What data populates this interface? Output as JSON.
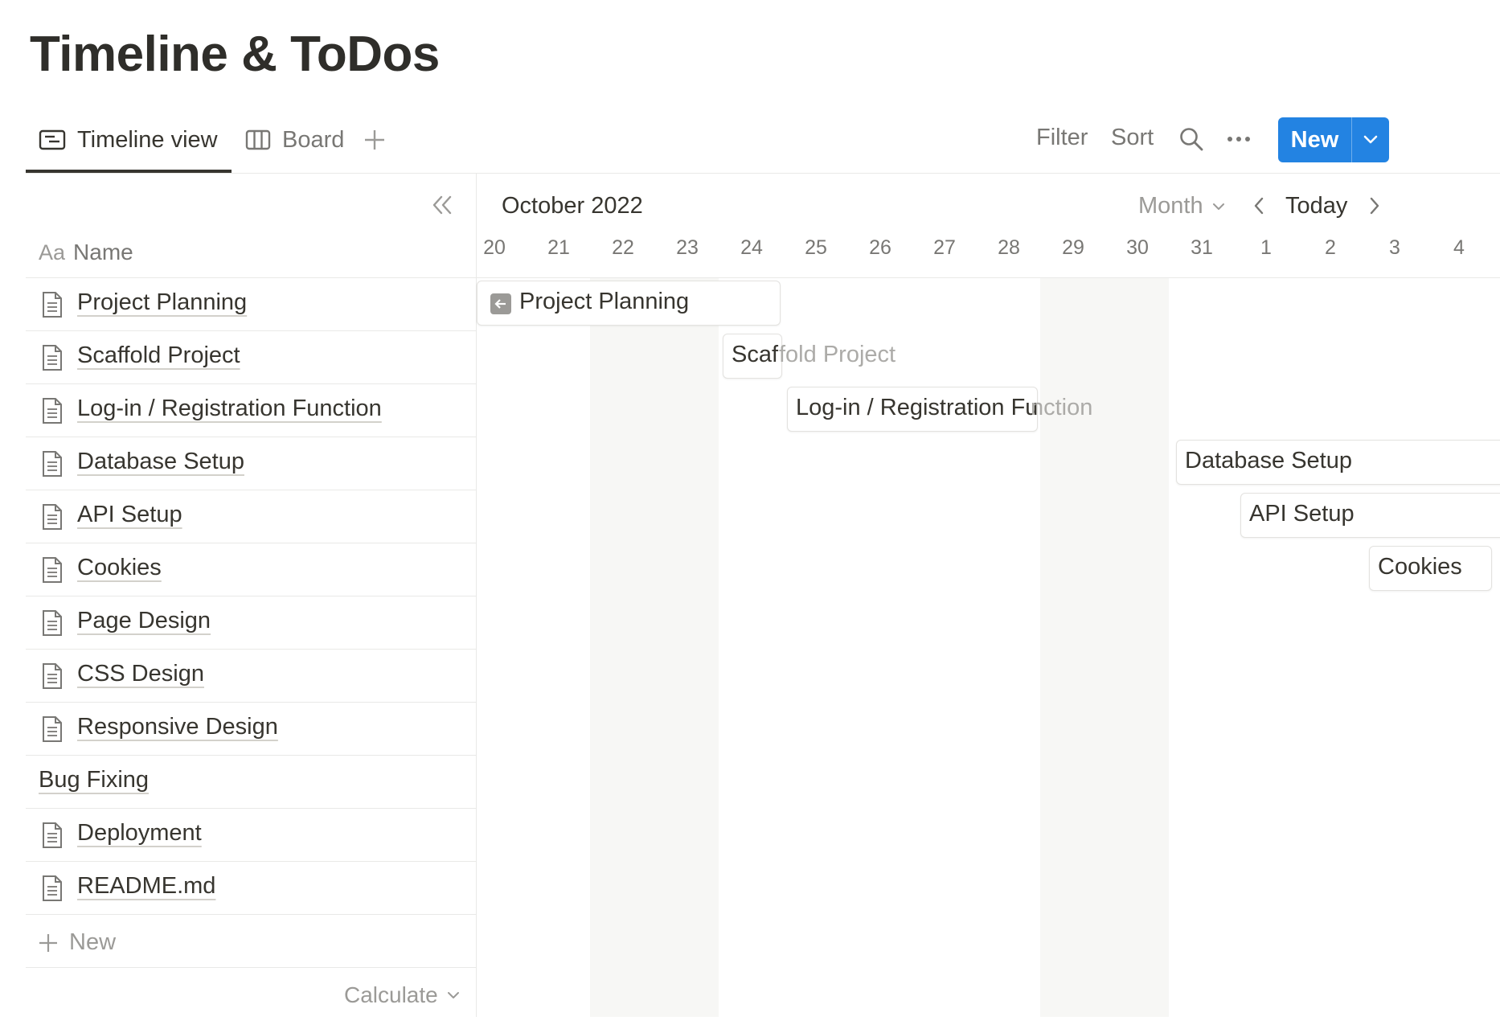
{
  "page": {
    "title": "Timeline & ToDos"
  },
  "views": {
    "tabs": [
      {
        "label": "Timeline view",
        "icon": "timeline-view-icon",
        "active": true
      },
      {
        "label": "Board",
        "icon": "board-view-icon",
        "active": false
      }
    ],
    "add_icon": "plus-icon"
  },
  "toolbar": {
    "filter_label": "Filter",
    "sort_label": "Sort",
    "search_icon": "search-icon",
    "more_icon": "more-horizontal-icon",
    "new_label": "New",
    "new_dropdown_icon": "chevron-down-icon",
    "accent_color": "#2383e2"
  },
  "table": {
    "name_header_prefix": "Aa",
    "name_header": "Name",
    "rows": [
      {
        "name": "Project Planning",
        "has_doc_icon": true
      },
      {
        "name": "Scaffold Project",
        "has_doc_icon": true
      },
      {
        "name": "Log-in / Registration Function",
        "has_doc_icon": true
      },
      {
        "name": "Database Setup",
        "has_doc_icon": true
      },
      {
        "name": "API Setup",
        "has_doc_icon": true
      },
      {
        "name": "Cookies",
        "has_doc_icon": true
      },
      {
        "name": "Page Design",
        "has_doc_icon": true
      },
      {
        "name": "CSS Design",
        "has_doc_icon": true
      },
      {
        "name": "Responsive Design",
        "has_doc_icon": true
      },
      {
        "name": "Bug Fixing",
        "has_doc_icon": false
      },
      {
        "name": "Deployment",
        "has_doc_icon": true
      },
      {
        "name": "README.md",
        "has_doc_icon": true
      }
    ],
    "add_new_label": "New",
    "calculate_label": "Calculate"
  },
  "timeline": {
    "month_label": "October 2022",
    "mode_label": "Month",
    "today_label": "Today",
    "days": [
      "20",
      "21",
      "22",
      "23",
      "24",
      "25",
      "26",
      "27",
      "28",
      "29",
      "30",
      "31",
      "1",
      "2",
      "3",
      "4"
    ],
    "bars": [
      {
        "label": "Project Planning",
        "visible_text": "Project Planning",
        "overflow_text": ""
      },
      {
        "label": "Scaffold Project",
        "visible_text": "Scaf",
        "overflow_text": "fold Project"
      },
      {
        "label": "Log-in / Registration Function",
        "visible_text": "Log-in / Registration Fu",
        "overflow_text": "nction"
      },
      {
        "label": "Database Setup",
        "visible_text": "Database Setup",
        "overflow_text": ""
      },
      {
        "label": "API Setup",
        "visible_text": "API Setup",
        "overflow_text": ""
      },
      {
        "label": "Cookies",
        "visible_text": "Cookies",
        "overflow_text": ""
      }
    ]
  }
}
